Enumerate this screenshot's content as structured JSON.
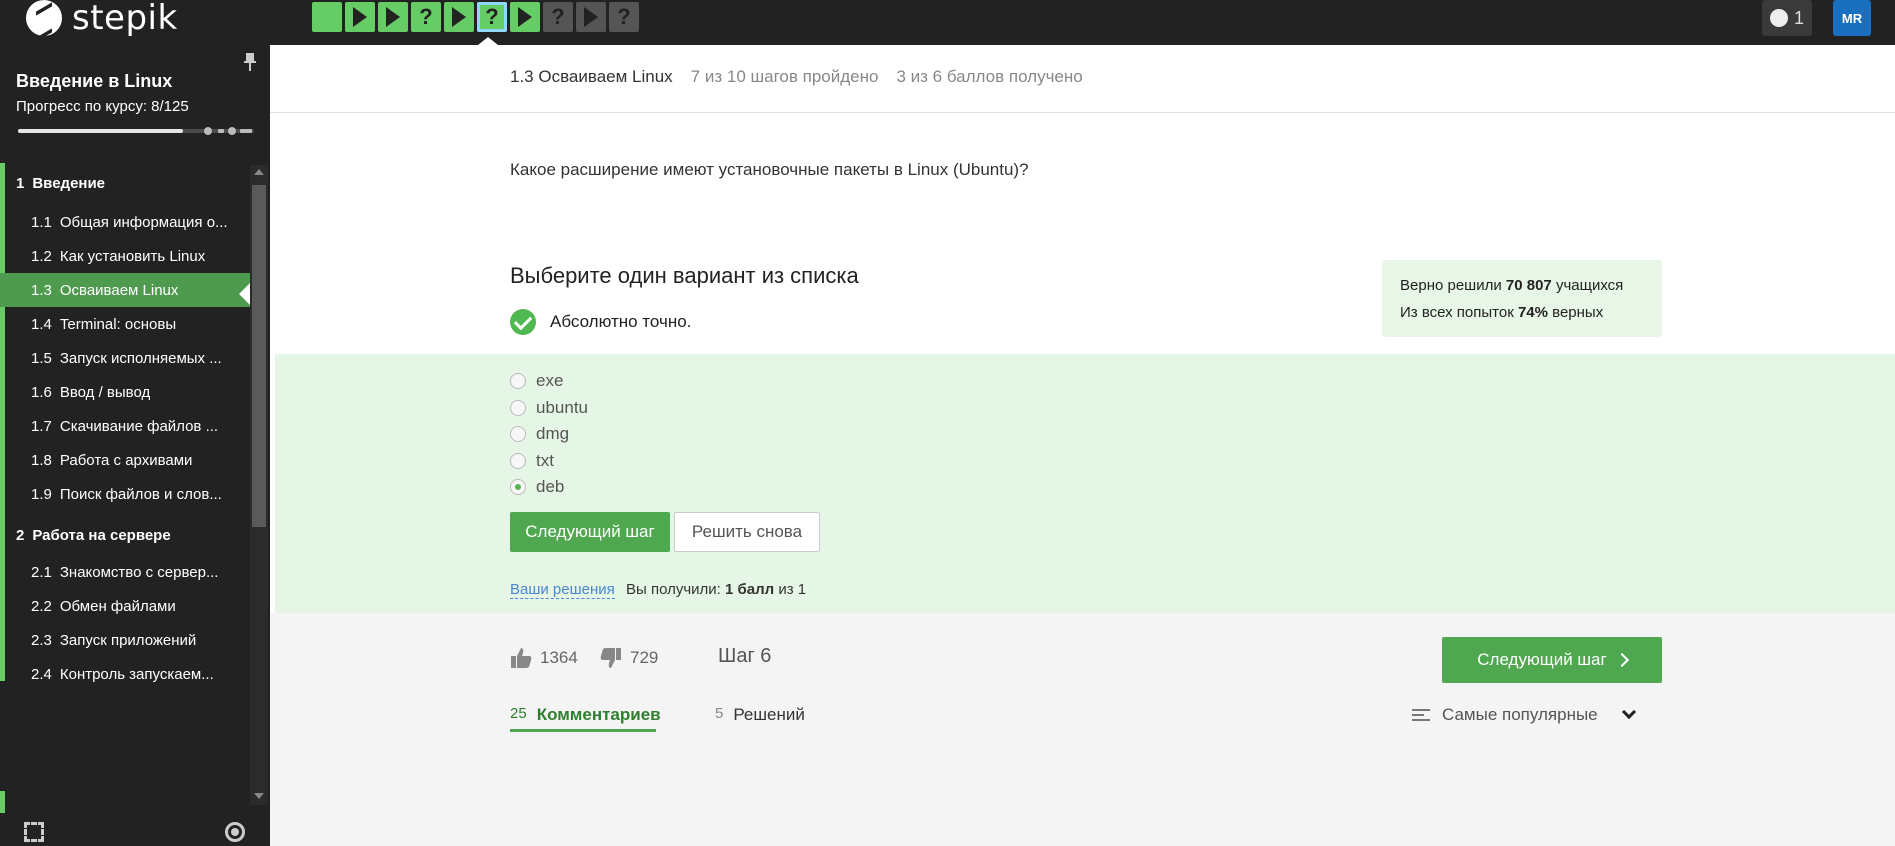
{
  "brand": {
    "name": "stepik"
  },
  "steps": [
    {
      "kind": "done",
      "icon": "square"
    },
    {
      "kind": "done",
      "icon": "play"
    },
    {
      "kind": "done",
      "icon": "play"
    },
    {
      "kind": "done",
      "icon": "question",
      "label": "?"
    },
    {
      "kind": "done",
      "icon": "play"
    },
    {
      "kind": "done",
      "icon": "question",
      "label": "?",
      "active": true
    },
    {
      "kind": "done",
      "icon": "play"
    },
    {
      "kind": "todo",
      "icon": "question",
      "label": "?"
    },
    {
      "kind": "todo",
      "icon": "play"
    },
    {
      "kind": "todo",
      "icon": "question",
      "label": "?"
    }
  ],
  "header": {
    "trophy_count": "1",
    "avatar_initials": "MR"
  },
  "sidebar": {
    "course_title": "Введение в Linux",
    "progress_label": "Прогресс по курсу:  8/125",
    "progress_fraction": 0.064,
    "items": [
      {
        "type": "section",
        "num": "1",
        "label": "Введение"
      },
      {
        "type": "lesson",
        "num": "1.1",
        "label": "Общая информация о..."
      },
      {
        "type": "lesson",
        "num": "1.2",
        "label": "Как установить Linux"
      },
      {
        "type": "lesson",
        "num": "1.3",
        "label": "Осваиваем Linux",
        "active": true
      },
      {
        "type": "lesson",
        "num": "1.4",
        "label": "Terminal: основы"
      },
      {
        "type": "lesson",
        "num": "1.5",
        "label": "Запуск исполняемых ..."
      },
      {
        "type": "lesson",
        "num": "1.6",
        "label": "Ввод / вывод"
      },
      {
        "type": "lesson",
        "num": "1.7",
        "label": "Скачивание файлов ..."
      },
      {
        "type": "lesson",
        "num": "1.8",
        "label": "Работа с архивами"
      },
      {
        "type": "lesson",
        "num": "1.9",
        "label": "Поиск файлов и слов..."
      },
      {
        "type": "section",
        "num": "2",
        "label": "Работа на сервере"
      },
      {
        "type": "lesson",
        "num": "2.1",
        "label": "Знакомство с сервер..."
      },
      {
        "type": "lesson",
        "num": "2.2",
        "label": "Обмен файлами"
      },
      {
        "type": "lesson",
        "num": "2.3",
        "label": "Запуск приложений"
      },
      {
        "type": "lesson",
        "num": "2.4",
        "label": "Контроль запускаем..."
      }
    ]
  },
  "lesson": {
    "title": "1.3 Осваиваем Linux",
    "steps_progress": "7 из 10 шагов пройдено",
    "points_progress": "3 из 6 баллов  получено"
  },
  "quiz": {
    "question": "Какое расширение имеют установочные пакеты в Linux (Ubuntu)?",
    "instruction": "Выберите один вариант из списка",
    "verdict": "Абсолютно точно.",
    "stats": {
      "line1_prefix": "Верно решили ",
      "line1_value": "70 807",
      "line1_suffix": " учащихся",
      "line2_prefix": "Из всех попыток ",
      "line2_value": "74%",
      "line2_suffix": " верных"
    },
    "options": [
      {
        "label": "exe",
        "checked": false
      },
      {
        "label": "ubuntu",
        "checked": false
      },
      {
        "label": "dmg",
        "checked": false
      },
      {
        "label": "txt",
        "checked": false
      },
      {
        "label": "deb",
        "checked": true
      }
    ],
    "next_button": "Следующий шаг",
    "retry_button": "Решить снова",
    "solutions_link": "Ваши решения",
    "score_prefix": "Вы получили: ",
    "score_value": "1 балл",
    "score_suffix": " из 1"
  },
  "footer": {
    "likes": "1364",
    "dislikes": "729",
    "step_label": "Шаг 6",
    "next_button": "Следующий шаг",
    "tabs": [
      {
        "count": "25",
        "label": "Комментариев"
      },
      {
        "count": "5",
        "label": "Решений"
      }
    ],
    "sort_label": "Самые популярные"
  }
}
